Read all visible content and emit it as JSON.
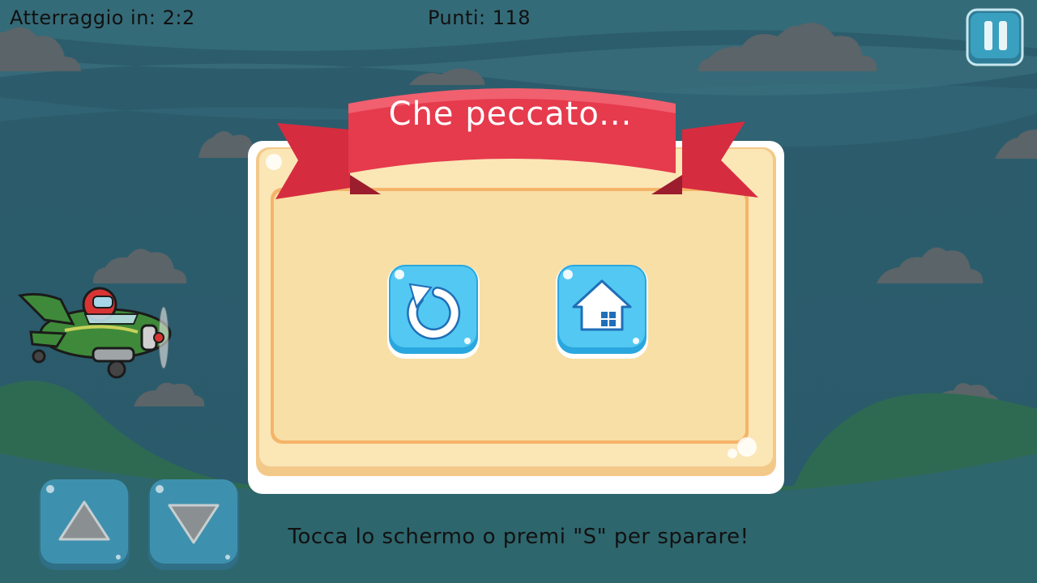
{
  "hud": {
    "landing_label": "Atterraggio in: 2:2",
    "score_label": "Punti: 118"
  },
  "dialog": {
    "title": "Che peccato..."
  },
  "hint": {
    "text": "Tocca lo schermo o premi \"S\" per sparare!"
  },
  "icons": {
    "pause": "pause-icon",
    "retry": "retry-icon",
    "home": "home-icon",
    "up": "arrow-up-icon",
    "down": "arrow-down-icon"
  },
  "colors": {
    "sky": "#2b5f6e",
    "banner": "#e63a4d",
    "panel": "#f7e0ad",
    "button": "#4cc3ee",
    "control": "#3d8aa6"
  }
}
